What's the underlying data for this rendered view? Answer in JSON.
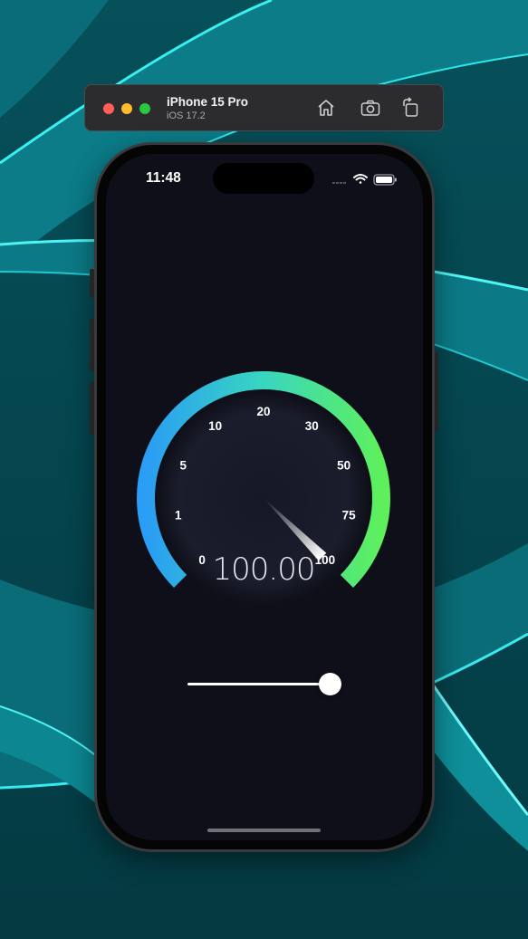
{
  "simulator": {
    "device_name": "iPhone 15 Pro",
    "os_version": "iOS 17.2",
    "toolbar": [
      "home-icon",
      "screenshot-icon",
      "rotate-icon"
    ]
  },
  "status_bar": {
    "time": "11:48",
    "icons": [
      "signal-icon",
      "wifi-icon",
      "battery-icon"
    ]
  },
  "gauge": {
    "tick_labels": [
      "0",
      "1",
      "5",
      "10",
      "20",
      "30",
      "50",
      "75",
      "100"
    ],
    "readout": "100.00",
    "value_fraction": 1.0,
    "gradient_colors": [
      "#2a9df4",
      "#38d6c0",
      "#5ef05c"
    ]
  },
  "slider": {
    "value_fraction": 1.0
  }
}
